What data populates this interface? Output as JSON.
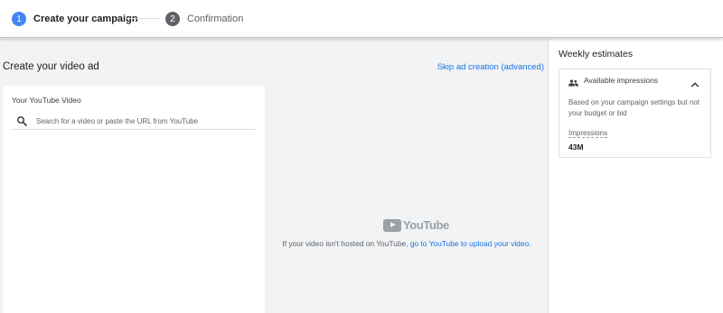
{
  "stepper": {
    "steps": [
      {
        "number": "1",
        "label": "Create your campaign",
        "state": "active"
      },
      {
        "number": "2",
        "label": "Confirmation",
        "state": "upcoming"
      }
    ]
  },
  "main": {
    "title": "Create your video ad",
    "skip_link": "Skip ad creation (advanced)"
  },
  "video_card": {
    "label": "Your YouTube Video",
    "search_placeholder": "Search for a video or paste the URL from YouTube",
    "search_value": "",
    "search_icon": "search-icon"
  },
  "preview": {
    "logo_text": "YouTube",
    "message": "If your video isn't hosted on YouTube,",
    "link_text": "go to YouTube to upload your video."
  },
  "sidebar": {
    "title": "Weekly estimates",
    "card": {
      "header": "Available impressions",
      "header_icon": "people-icon",
      "expanded": true,
      "description": "Based on your campaign settings but not your budget or bid",
      "metric_label": "Impressions",
      "metric_value": "43M"
    }
  },
  "colors": {
    "accent": "#4285f4",
    "link": "#1a73e8",
    "step_inactive": "#5f6368",
    "canvas": "#f1f3f4"
  }
}
